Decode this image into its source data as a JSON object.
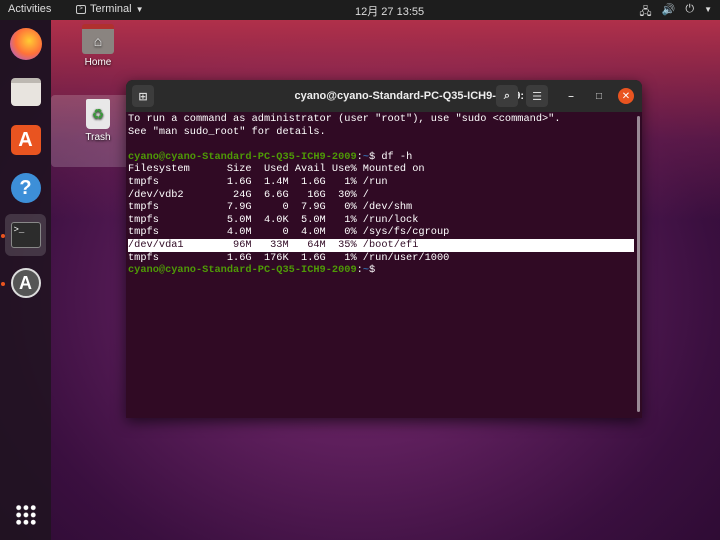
{
  "topbar": {
    "activities": "Activities",
    "app_name": "Terminal",
    "clock": "12月 27  13:55"
  },
  "desktop": {
    "home_label": "Home",
    "trash_label": "Trash"
  },
  "dock": {
    "items": [
      "Firefox",
      "Files",
      "Ubuntu Software",
      "Help",
      "Terminal",
      "Software Updater",
      "Show Applications"
    ]
  },
  "window": {
    "title": "cyano@cyano-Standard-PC-Q35-ICH9-2009: ~"
  },
  "terminal": {
    "prompt_user": "cyano@cyano-Standard-PC-Q35-ICH9-2009",
    "prompt_colon": ":",
    "prompt_dir": "~",
    "prompt_dollar": "$ ",
    "command": "df -h",
    "lines": [
      "To run a command as administrator (user \"root\"), use \"sudo <command>\".",
      "See \"man sudo_root\" for details.",
      ""
    ],
    "table": [
      "Filesystem      Size  Used Avail Use% Mounted on",
      "tmpfs           1.6G  1.4M  1.6G   1% /run",
      "/dev/vdb2        24G  6.6G   16G  30% /",
      "tmpfs           7.9G     0  7.9G   0% /dev/shm",
      "tmpfs           5.0M  4.0K  5.0M   1% /run/lock",
      "tmpfs           4.0M     0  4.0M   0% /sys/fs/cgroup",
      "/dev/vda1        96M   33M   64M  35% /boot/efi",
      "tmpfs           1.6G  176K  1.6G   1% /run/user/1000"
    ],
    "highlighted_row": 6
  }
}
